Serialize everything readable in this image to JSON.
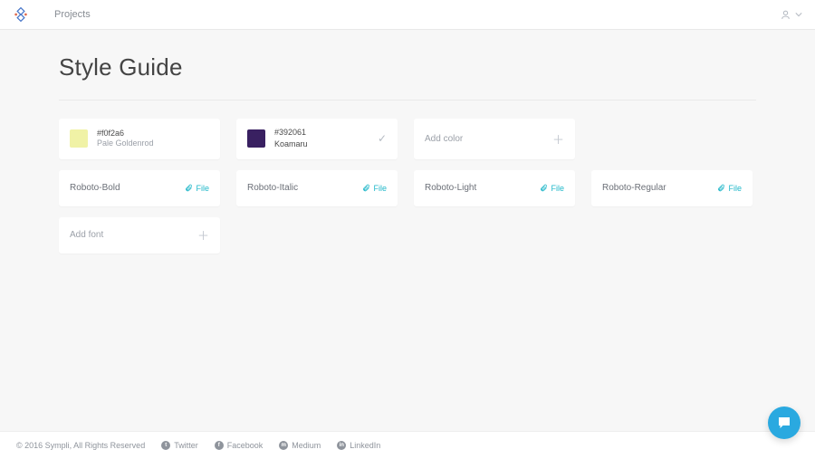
{
  "header": {
    "projects_label": "Projects"
  },
  "page": {
    "title": "Style Guide"
  },
  "colors": [
    {
      "hex": "#f0f2a6",
      "name": "Pale Goldenrod",
      "swatch": "#f0f2a6",
      "editing": false
    },
    {
      "hex": "#392061",
      "name": "Koamaru",
      "swatch": "#392061",
      "editing": true
    }
  ],
  "add_color_label": "Add color",
  "fonts": [
    {
      "name": "Roboto-Bold",
      "file_label": "File"
    },
    {
      "name": "Roboto-Italic",
      "file_label": "File"
    },
    {
      "name": "Roboto-Light",
      "file_label": "File"
    },
    {
      "name": "Roboto-Regular",
      "file_label": "File"
    }
  ],
  "add_font_label": "Add font",
  "footer": {
    "copyright": "© 2016 Sympli, All Rights Reserved",
    "links": [
      "Twitter",
      "Facebook",
      "Medium",
      "LinkedIn"
    ]
  }
}
